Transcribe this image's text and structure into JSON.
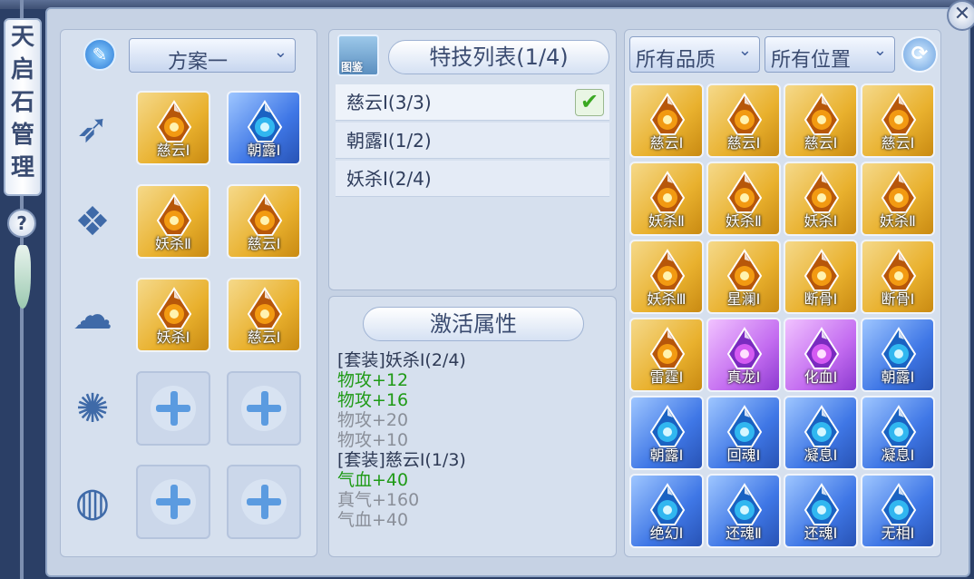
{
  "sidebar": {
    "title_chars": [
      "天",
      "启",
      "石",
      "管",
      "理"
    ],
    "help_label": "?"
  },
  "scheme": {
    "selected": "方案一"
  },
  "equipped_slots": [
    {
      "icon": "weapon-icon",
      "items": [
        {
          "name": "慈云Ⅰ",
          "quality": "gold"
        },
        {
          "name": "朝露Ⅰ",
          "quality": "blue"
        }
      ]
    },
    {
      "icon": "armor-icon",
      "items": [
        {
          "name": "妖杀Ⅱ",
          "quality": "gold"
        },
        {
          "name": "慈云Ⅰ",
          "quality": "gold"
        }
      ]
    },
    {
      "icon": "cloud-icon",
      "items": [
        {
          "name": "妖杀Ⅰ",
          "quality": "gold"
        },
        {
          "name": "慈云Ⅰ",
          "quality": "gold"
        }
      ]
    },
    {
      "icon": "spiral-icon",
      "items": [
        {
          "name": "",
          "quality": "empty"
        },
        {
          "name": "",
          "quality": "empty"
        }
      ]
    },
    {
      "icon": "drum-icon",
      "items": [
        {
          "name": "",
          "quality": "empty"
        },
        {
          "name": "",
          "quality": "empty"
        }
      ]
    }
  ],
  "skills": {
    "book_label": "图鉴",
    "title": "特技列表(1/4)",
    "rows": [
      {
        "label": "慈云Ⅰ(3/3)",
        "checked": true
      },
      {
        "label": "朝露Ⅰ(1/2)",
        "checked": false
      },
      {
        "label": "妖杀Ⅰ(2/4)",
        "checked": false
      }
    ]
  },
  "attributes": {
    "title": "激活属性",
    "lines": [
      {
        "text": "[套装]妖杀Ⅰ(2/4)",
        "style": "dark"
      },
      {
        "text": "物攻+12",
        "style": "green"
      },
      {
        "text": "物攻+16",
        "style": "green"
      },
      {
        "text": "物攻+20",
        "style": "gray"
      },
      {
        "text": "物攻+10",
        "style": "gray"
      },
      {
        "text": "[套装]慈云Ⅰ(1/3)",
        "style": "dark"
      },
      {
        "text": "气血+40",
        "style": "green"
      },
      {
        "text": "真气+160",
        "style": "gray"
      },
      {
        "text": "气血+40",
        "style": "gray"
      }
    ]
  },
  "filters": {
    "quality": "所有品质",
    "position": "所有位置"
  },
  "inventory": [
    {
      "name": "慈云Ⅰ",
      "quality": "gold"
    },
    {
      "name": "慈云Ⅰ",
      "quality": "gold"
    },
    {
      "name": "慈云Ⅰ",
      "quality": "gold"
    },
    {
      "name": "慈云Ⅰ",
      "quality": "gold"
    },
    {
      "name": "妖杀Ⅱ",
      "quality": "gold"
    },
    {
      "name": "妖杀Ⅱ",
      "quality": "gold"
    },
    {
      "name": "妖杀Ⅰ",
      "quality": "gold"
    },
    {
      "name": "妖杀Ⅱ",
      "quality": "gold"
    },
    {
      "name": "妖杀Ⅲ",
      "quality": "gold"
    },
    {
      "name": "星澜Ⅰ",
      "quality": "gold"
    },
    {
      "name": "断骨Ⅰ",
      "quality": "gold"
    },
    {
      "name": "断骨Ⅰ",
      "quality": "gold"
    },
    {
      "name": "雷霆Ⅰ",
      "quality": "gold"
    },
    {
      "name": "真龙Ⅰ",
      "quality": "purple"
    },
    {
      "name": "化血Ⅰ",
      "quality": "purple"
    },
    {
      "name": "朝露Ⅰ",
      "quality": "blue"
    },
    {
      "name": "朝露Ⅰ",
      "quality": "blue"
    },
    {
      "name": "回魂Ⅰ",
      "quality": "blue"
    },
    {
      "name": "凝息Ⅰ",
      "quality": "blue"
    },
    {
      "name": "凝息Ⅰ",
      "quality": "blue"
    },
    {
      "name": "绝幻Ⅰ",
      "quality": "blue"
    },
    {
      "name": "还魂Ⅱ",
      "quality": "blue"
    },
    {
      "name": "还魂Ⅰ",
      "quality": "blue"
    },
    {
      "name": "无相Ⅰ",
      "quality": "blue"
    }
  ],
  "colors": {
    "gold": "#e9b12e",
    "blue": "#3f77e6",
    "purple": "#c36cf0",
    "accent": "#3a4b70"
  }
}
